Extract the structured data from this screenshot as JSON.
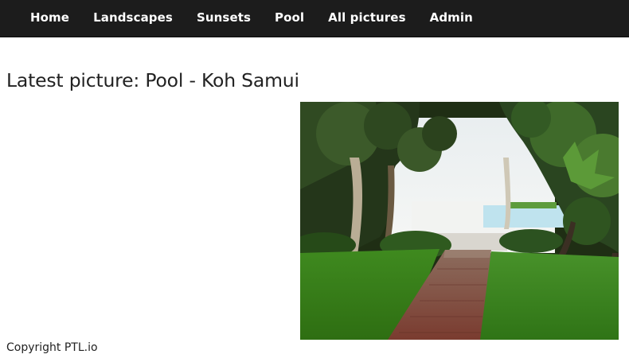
{
  "nav": {
    "items": [
      {
        "label": "Home"
      },
      {
        "label": "Landscapes"
      },
      {
        "label": "Sunsets"
      },
      {
        "label": "Pool"
      },
      {
        "label": "All pictures"
      },
      {
        "label": "Admin"
      }
    ]
  },
  "main": {
    "title": "Latest picture: Pool - Koh Samui"
  },
  "footer": {
    "copyright": "Copyright PTL.io"
  },
  "colors": {
    "navbar_bg": "#1c1c1c",
    "nav_text": "#ffffff",
    "page_bg": "#ffffff"
  }
}
